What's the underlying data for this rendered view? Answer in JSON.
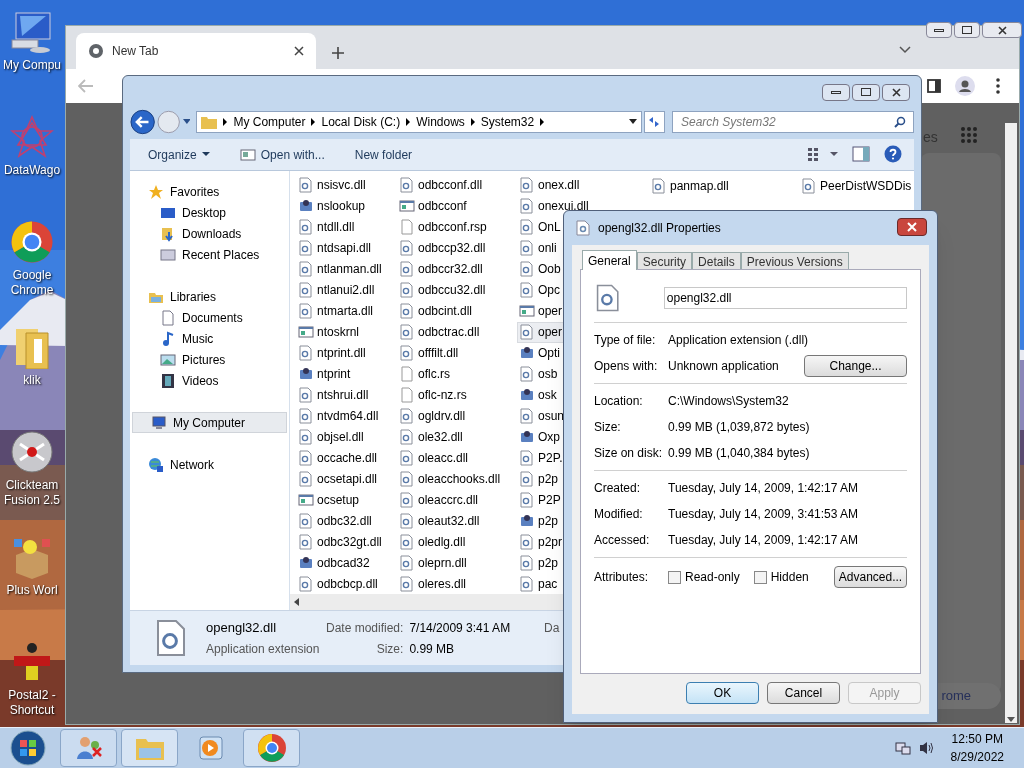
{
  "desktop": {
    "icons": [
      {
        "label": "My Compu",
        "kind": "computer"
      },
      {
        "label": "DataWago",
        "kind": "star"
      },
      {
        "label": "Google Chrome",
        "kind": "chrome"
      },
      {
        "label": "klik",
        "kind": "folder"
      },
      {
        "label": "Clickteam Fusion 2.5",
        "kind": "orb"
      },
      {
        "label": "Plus Worl",
        "kind": "box"
      },
      {
        "label": "Postal2 - Shortcut",
        "kind": "game"
      }
    ]
  },
  "browser": {
    "tab": {
      "title": "New Tab"
    },
    "page_text": "es",
    "page_button": "rome"
  },
  "explorer": {
    "breadcrumb": [
      "My Computer",
      "Local Disk (C:)",
      "Windows",
      "System32"
    ],
    "search": {
      "placeholder": "Search System32"
    },
    "toolbar": [
      "Organize",
      "Open with...",
      "New folder"
    ],
    "nav": [
      {
        "label": "Favorites",
        "selected": false,
        "children": [
          {
            "label": "Desktop",
            "selected": false
          },
          {
            "label": "Downloads",
            "selected": false
          },
          {
            "label": "Recent Places",
            "selected": false
          }
        ]
      },
      {
        "label": "Libraries",
        "selected": false,
        "children": [
          {
            "label": "Documents",
            "selected": false
          },
          {
            "label": "Music",
            "selected": false
          },
          {
            "label": "Pictures",
            "selected": false
          },
          {
            "label": "Videos",
            "selected": false
          }
        ]
      },
      {
        "label": "My Computer",
        "selected": true
      },
      {
        "label": "Network",
        "selected": false
      }
    ],
    "files": [
      [
        {
          "name": "nsisvc.dll",
          "kind": "dll",
          "selected": false
        },
        {
          "name": "nslookup",
          "kind": "tool",
          "selected": false
        },
        {
          "name": "ntdll.dll",
          "kind": "dll",
          "selected": false
        },
        {
          "name": "ntdsapi.dll",
          "kind": "dll",
          "selected": false
        },
        {
          "name": "ntlanman.dll",
          "kind": "dll",
          "selected": false
        },
        {
          "name": "ntlanui2.dll",
          "kind": "dll",
          "selected": false
        },
        {
          "name": "ntmarta.dll",
          "kind": "dll",
          "selected": false
        },
        {
          "name": "ntoskrnl",
          "kind": "app",
          "selected": false
        },
        {
          "name": "ntprint.dll",
          "kind": "dll",
          "selected": false
        },
        {
          "name": "ntprint",
          "kind": "tool",
          "selected": false
        },
        {
          "name": "ntshrui.dll",
          "kind": "dll",
          "selected": false
        },
        {
          "name": "ntvdm64.dll",
          "kind": "dll",
          "selected": false
        },
        {
          "name": "objsel.dll",
          "kind": "dll",
          "selected": false
        },
        {
          "name": "occache.dll",
          "kind": "dll",
          "selected": false
        },
        {
          "name": "ocsetapi.dll",
          "kind": "dll",
          "selected": false
        },
        {
          "name": "ocsetup",
          "kind": "app",
          "selected": false
        },
        {
          "name": "odbc32.dll",
          "kind": "dll",
          "selected": false
        },
        {
          "name": "odbc32gt.dll",
          "kind": "dll",
          "selected": false
        },
        {
          "name": "odbcad32",
          "kind": "tool",
          "selected": false
        },
        {
          "name": "odbcbcp.dll",
          "kind": "dll",
          "selected": false
        }
      ],
      [
        {
          "name": "odbcconf.dll",
          "kind": "dll",
          "selected": false
        },
        {
          "name": "odbcconf",
          "kind": "app",
          "selected": false
        },
        {
          "name": "odbcconf.rsp",
          "kind": "blank",
          "selected": false
        },
        {
          "name": "odbccp32.dll",
          "kind": "dll",
          "selected": false
        },
        {
          "name": "odbccr32.dll",
          "kind": "dll",
          "selected": false
        },
        {
          "name": "odbccu32.dll",
          "kind": "dll",
          "selected": false
        },
        {
          "name": "odbcint.dll",
          "kind": "dll",
          "selected": false
        },
        {
          "name": "odbctrac.dll",
          "kind": "dll",
          "selected": false
        },
        {
          "name": "offfilt.dll",
          "kind": "dll",
          "selected": false
        },
        {
          "name": "oflc.rs",
          "kind": "blank",
          "selected": false
        },
        {
          "name": "oflc-nz.rs",
          "kind": "blank",
          "selected": false
        },
        {
          "name": "ogldrv.dll",
          "kind": "dll",
          "selected": false
        },
        {
          "name": "ole32.dll",
          "kind": "dll",
          "selected": false
        },
        {
          "name": "oleacc.dll",
          "kind": "dll",
          "selected": false
        },
        {
          "name": "oleacchooks.dll",
          "kind": "dll",
          "selected": false
        },
        {
          "name": "oleaccrc.dll",
          "kind": "dll",
          "selected": false
        },
        {
          "name": "oleaut32.dll",
          "kind": "dll",
          "selected": false
        },
        {
          "name": "oledlg.dll",
          "kind": "dll",
          "selected": false
        },
        {
          "name": "oleprn.dll",
          "kind": "dll",
          "selected": false
        },
        {
          "name": "oleres.dll",
          "kind": "dll",
          "selected": false
        }
      ],
      [
        {
          "name": "onex.dll",
          "kind": "dll",
          "selected": false
        },
        {
          "name": "onexui.dll",
          "kind": "dll",
          "selected": false
        },
        {
          "name": "OnL",
          "kind": "dll",
          "selected": false
        },
        {
          "name": "onli",
          "kind": "dll",
          "selected": false
        },
        {
          "name": "Oob",
          "kind": "dll",
          "selected": false
        },
        {
          "name": "Opc",
          "kind": "dll",
          "selected": false
        },
        {
          "name": "oper",
          "kind": "app",
          "selected": false
        },
        {
          "name": "oper",
          "kind": "dll",
          "selected": true
        },
        {
          "name": "Opti",
          "kind": "tool",
          "selected": false
        },
        {
          "name": "osb",
          "kind": "dll",
          "selected": false
        },
        {
          "name": "osk",
          "kind": "tool",
          "selected": false
        },
        {
          "name": "osun",
          "kind": "dll",
          "selected": false
        },
        {
          "name": "Oxp",
          "kind": "tool",
          "selected": false
        },
        {
          "name": "P2P.",
          "kind": "dll",
          "selected": false
        },
        {
          "name": "p2p",
          "kind": "dll",
          "selected": false
        },
        {
          "name": "P2P",
          "kind": "dll",
          "selected": false
        },
        {
          "name": "p2p",
          "kind": "tool",
          "selected": false
        },
        {
          "name": "p2pr",
          "kind": "dll",
          "selected": false
        },
        {
          "name": "p2p",
          "kind": "dll",
          "selected": false
        },
        {
          "name": "pac",
          "kind": "dll",
          "selected": false
        }
      ],
      [
        {
          "name": "panmap.dll",
          "kind": "dll",
          "selected": false
        }
      ],
      [
        {
          "name": "PeerDistWSDDis",
          "kind": "dll",
          "selected": false
        }
      ]
    ],
    "details": {
      "name": "opengl32.dll",
      "type": "Application extension",
      "fields": [
        {
          "label": "Date modified:",
          "value": "7/14/2009 3:41 AM"
        },
        {
          "label": "Size:",
          "value": "0.99 MB"
        }
      ],
      "cut_label": "Da"
    }
  },
  "properties": {
    "title": "opengl32.dll Properties",
    "tabs": [
      {
        "label": "General",
        "selected": true
      },
      {
        "label": "Security",
        "selected": false
      },
      {
        "label": "Details",
        "selected": false
      },
      {
        "label": "Previous Versions",
        "selected": false
      }
    ],
    "file_name": "opengl32.dll",
    "groups": [
      [
        {
          "label": "Type of file:",
          "value": "Application extension (.dll)"
        },
        {
          "label": "Opens with:",
          "value": "Unknown application",
          "button": "Change..."
        }
      ],
      [
        {
          "label": "Location:",
          "value": "C:\\Windows\\System32"
        },
        {
          "label": "Size:",
          "value": "0.99 MB (1,039,872 bytes)"
        },
        {
          "label": "Size on disk:",
          "value": "0.99 MB (1,040,384 bytes)"
        }
      ],
      [
        {
          "label": "Created:",
          "value": "Tuesday, July 14, 2009, 1:42:17 AM"
        },
        {
          "label": "Modified:",
          "value": "Tuesday, July 14, 2009, 3:41:53 AM"
        },
        {
          "label": "Accessed:",
          "value": "Tuesday, July 14, 2009, 1:42:17 AM"
        }
      ]
    ],
    "attributes": {
      "label": "Attributes:",
      "options": [
        {
          "label": "Read-only",
          "checked": false
        },
        {
          "label": "Hidden",
          "checked": false
        }
      ],
      "button": "Advanced..."
    },
    "buttons": [
      {
        "label": "OK",
        "disabled": false,
        "default": true
      },
      {
        "label": "Cancel",
        "disabled": false,
        "default": false
      },
      {
        "label": "Apply",
        "disabled": true,
        "default": false
      }
    ]
  },
  "taskbar": {
    "time": "12:50 PM",
    "date": "8/29/2022"
  }
}
